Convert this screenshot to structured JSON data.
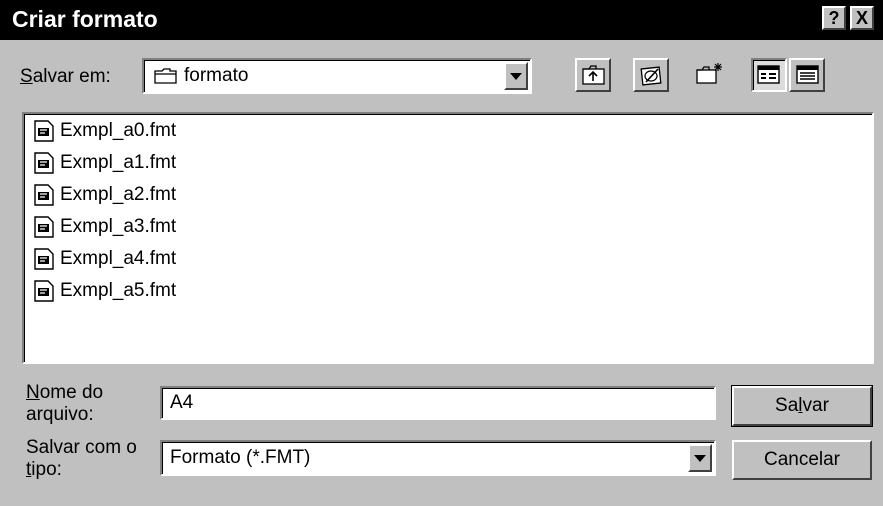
{
  "window": {
    "title": "Criar formato",
    "help_label": "?",
    "close_label": "X"
  },
  "save_in": {
    "label_access_key": "S",
    "label_rest": "alvar em:",
    "value": "formato"
  },
  "toolbar": {
    "icons": [
      "up-folder-icon",
      "desktop-icon",
      "new-folder-icon",
      "list-view-icon",
      "details-view-icon"
    ]
  },
  "files": [
    {
      "name": "Exmpl_a0.fmt"
    },
    {
      "name": "Exmpl_a1.fmt"
    },
    {
      "name": "Exmpl_a2.fmt"
    },
    {
      "name": "Exmpl_a3.fmt"
    },
    {
      "name": "Exmpl_a4.fmt"
    },
    {
      "name": "Exmpl_a5.fmt"
    }
  ],
  "filename": {
    "label_line1_key": "N",
    "label_line1_rest": "ome do",
    "label_line2": "arquivo:",
    "value": "A4"
  },
  "filetype": {
    "label_line1": "Salvar com o",
    "label_line2_key": "t",
    "label_line2_rest": "ipo:",
    "value": "Formato (*.FMT)"
  },
  "buttons": {
    "save_pre": "Sa",
    "save_key": "l",
    "save_post": "var",
    "cancel": "Cancelar"
  }
}
